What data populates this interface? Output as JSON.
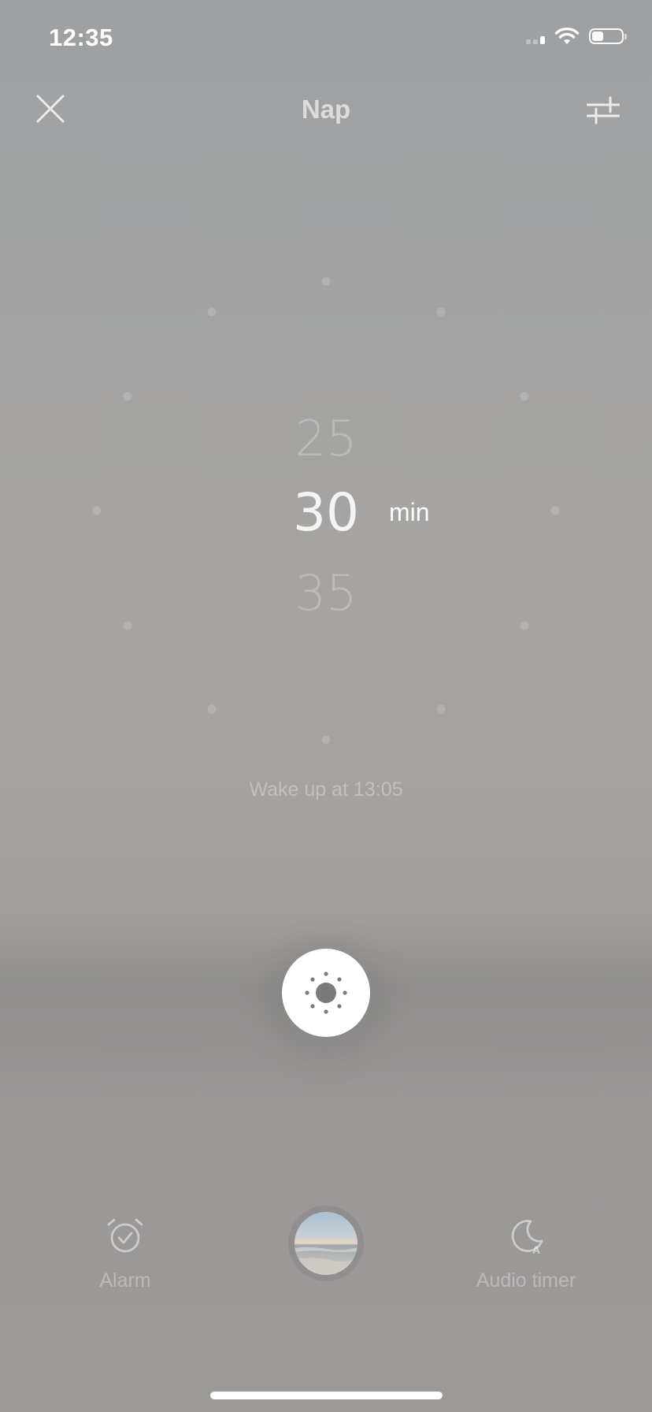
{
  "status_bar": {
    "time": "12:35",
    "signal_bars_active": 2,
    "battery_level": 0.4
  },
  "header": {
    "title": "Nap",
    "close_icon": "close-icon",
    "settings_icon": "sliders-icon"
  },
  "picker": {
    "previous": "25",
    "current": "30",
    "next": "35",
    "unit": "min"
  },
  "wake_text": "Wake up at 13:05",
  "start_button": {
    "icon": "sun-icon"
  },
  "bottom_bar": {
    "alarm_label": "Alarm",
    "alarm_icon": "alarm-clock-icon",
    "scene_icon": "beach-scene-thumbnail",
    "audio_timer_label": "Audio timer",
    "audio_timer_icon": "moon-auto-icon"
  },
  "colors": {
    "background": "#a3a2a0",
    "primary_text": "#ffffff",
    "muted_text": "rgba(255,255,255,0.32)"
  }
}
